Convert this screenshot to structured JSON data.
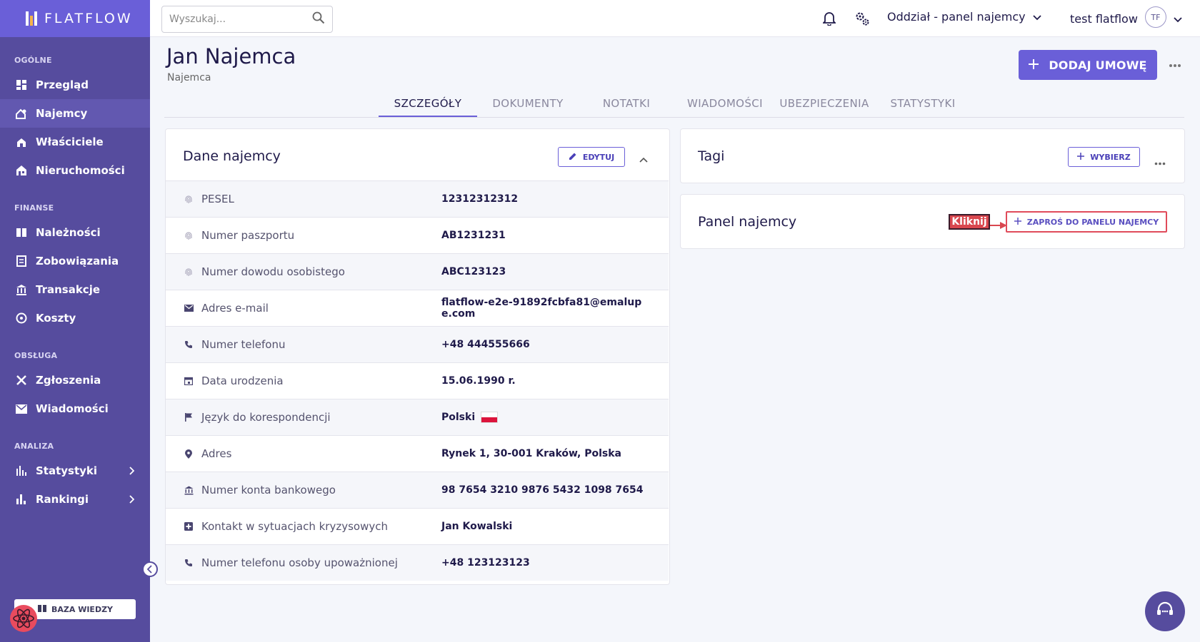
{
  "app": {
    "name": "FLATFLOW"
  },
  "sidebar": {
    "sections": [
      {
        "title": "OGÓLNE",
        "items": [
          "Przegląd",
          "Najemcy",
          "Właściciele",
          "Nieruchomości"
        ]
      },
      {
        "title": "FINANSE",
        "items": [
          "Należności",
          "Zobowiązania",
          "Transakcje",
          "Koszty"
        ]
      },
      {
        "title": "OBSŁUGA",
        "items": [
          "Zgłoszenia",
          "Wiadomości"
        ]
      },
      {
        "title": "ANALIZA",
        "items": [
          "Statystyki",
          "Rankingi"
        ]
      }
    ],
    "active_item": "Najemcy",
    "knowledge_base": "BAZA WIEDZY"
  },
  "topbar": {
    "search_placeholder": "Wyszukaj...",
    "branch": "Oddział - panel najemcy",
    "user_name": "test flatflow",
    "user_initials": "TF"
  },
  "page": {
    "title": "Jan Najemca",
    "subtitle": "Najemca",
    "add_button": "DODAJ UMOWĘ"
  },
  "tabs": [
    "SZCZEGÓŁY",
    "DOKUMENTY",
    "NOTATKI",
    "WIADOMOŚCI",
    "UBEZPIECZENIA",
    "STATYSTYKI"
  ],
  "tenant_card": {
    "title": "Dane najemcy",
    "edit_button": "EDYTUJ",
    "rows": [
      {
        "label": "PESEL",
        "value": "12312312312",
        "icon": "fingerprint-icon"
      },
      {
        "label": "Numer paszportu",
        "value": "AB1231231",
        "icon": "fingerprint-icon"
      },
      {
        "label": "Numer dowodu osobistego",
        "value": "ABC123123",
        "icon": "fingerprint-icon"
      },
      {
        "label": "Adres e-mail",
        "value": "flatflow-e2e-91892fcbfa81@emalupe.com",
        "icon": "mail-icon"
      },
      {
        "label": "Numer telefonu",
        "value": "+48 444555666",
        "icon": "phone-icon"
      },
      {
        "label": "Data urodzenia",
        "value": "15.06.1990 r.",
        "icon": "calendar-icon"
      },
      {
        "label": "Język do korespondencji",
        "value": "Polski",
        "icon": "flag-icon"
      },
      {
        "label": "Adres",
        "value": "Rynek 1, 30-001 Kraków, Polska",
        "icon": "location-icon"
      },
      {
        "label": "Numer konta bankowego",
        "value": "98 7654 3210 9876 5432 1098 7654",
        "icon": "bank-icon"
      },
      {
        "label": "Kontakt w sytuacjach kryzysowych",
        "value": "Jan Kowalski",
        "icon": "medical-icon"
      },
      {
        "label": "Numer telefonu osoby upoważnionej",
        "value": "+48 123123123",
        "icon": "phone-icon"
      }
    ]
  },
  "tags_card": {
    "title": "Tagi",
    "select_button": "WYBIERZ"
  },
  "panel_card": {
    "title": "Panel najemcy",
    "invite_button": "ZAPROŚ DO PANELU NAJEMCY",
    "annotation": "Kliknij"
  },
  "colors": {
    "accent": "#6a5fd8",
    "sidebar": "#564c9e",
    "highlight": "#e04b5a"
  }
}
